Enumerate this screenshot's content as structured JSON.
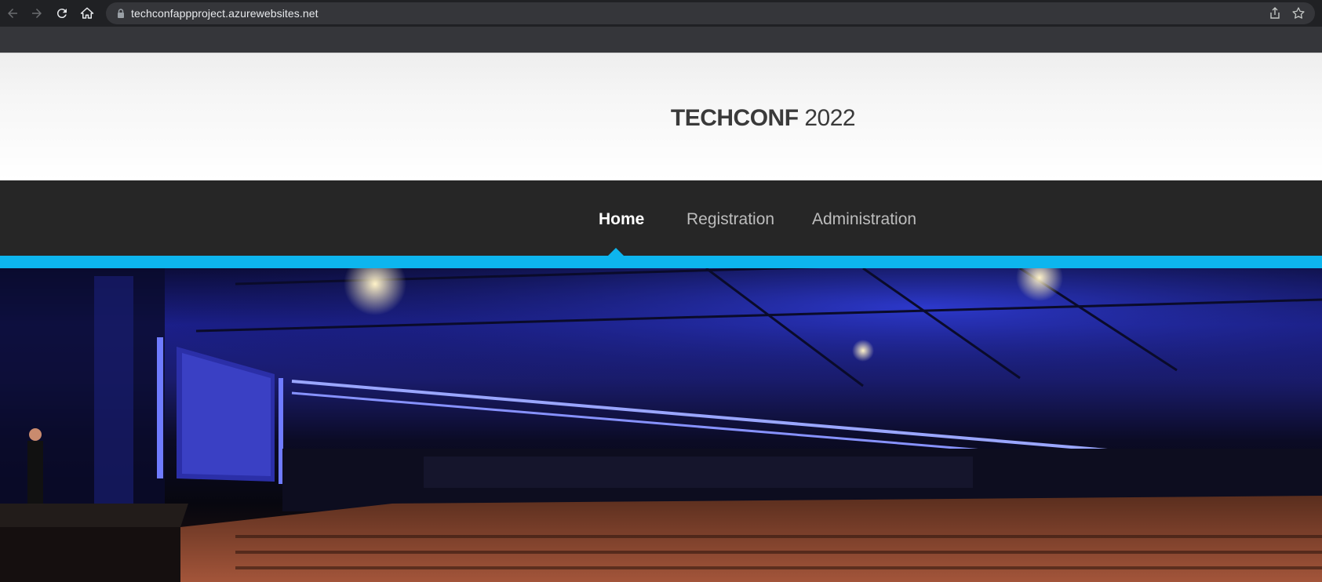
{
  "browser": {
    "url": "techconfappproject.azurewebsites.net",
    "icons": [
      "back-icon",
      "forward-icon",
      "reload-icon",
      "home-icon",
      "lock-icon",
      "share-icon",
      "bookmark-star-icon"
    ]
  },
  "site": {
    "brand_bold": "TECHCONF",
    "brand_year": "2022"
  },
  "nav": {
    "items": [
      {
        "label": "Home",
        "active": true
      },
      {
        "label": "Registration",
        "active": false
      },
      {
        "label": "Administration",
        "active": false
      }
    ]
  },
  "colors": {
    "accent": "#0db5ee",
    "navbar": "#262626",
    "brand_text": "#3a3a3a"
  },
  "hero": {
    "image": "conference-hall-photo"
  }
}
